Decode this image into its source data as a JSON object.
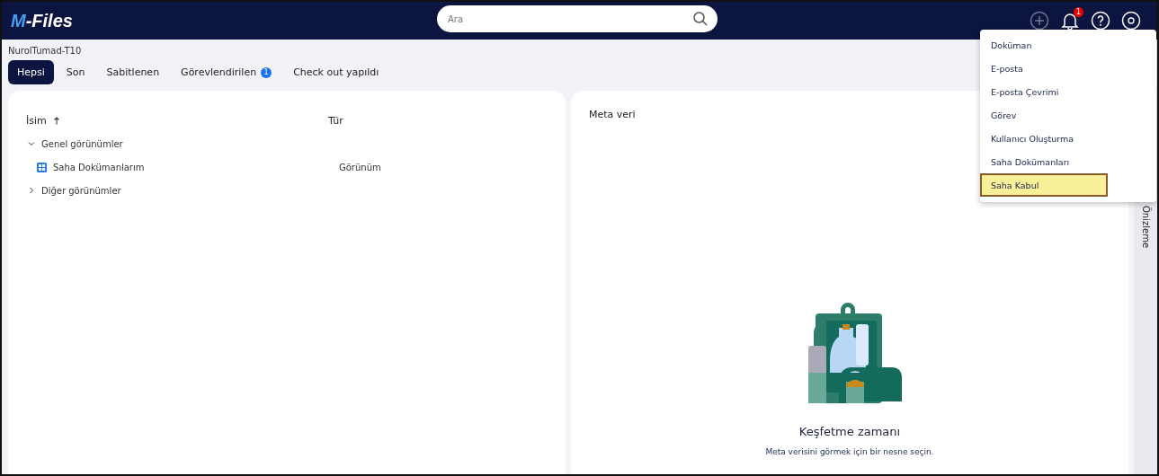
{
  "header": {
    "logo_accent": "M",
    "logo_rest": "-Files",
    "search": {
      "placeholder": "Ara"
    },
    "notification_count": "1"
  },
  "vault": "NurolTumad-T10",
  "tabs": [
    {
      "label": "Hepsi",
      "selected": true
    },
    {
      "label": "Son",
      "selected": false
    },
    {
      "label": "Sabitlenen",
      "selected": false
    },
    {
      "label": "Görevlendirilen",
      "selected": false,
      "badge": "1"
    },
    {
      "label": "Check out yapıldı",
      "selected": false
    }
  ],
  "table": {
    "columns": [
      "İsim",
      "Tür"
    ],
    "rows": [
      {
        "name": "Genel görünümler",
        "expanded": true,
        "children": [
          {
            "name": "Saha Dokümanlarım",
            "type": "Görünüm"
          }
        ]
      },
      {
        "name": "Diğer görünümler",
        "expanded": false,
        "children": []
      }
    ]
  },
  "metadata": {
    "title": "Meta veri",
    "empty_title": "Keşfetme zamanı",
    "empty_text": "Meta verisini görmek için bir nesne seçin."
  },
  "side_tab": "Önizleme",
  "new_menu": [
    {
      "label": "Doküman",
      "highlighted": false
    },
    {
      "label": "E-posta",
      "highlighted": false
    },
    {
      "label": "E-posta Çevrimi",
      "highlighted": false
    },
    {
      "label": "Görev",
      "highlighted": false
    },
    {
      "label": "Kullanıcı Oluşturma",
      "highlighted": false
    },
    {
      "label": "Saha Dokümanları",
      "highlighted": false
    },
    {
      "label": "Saha Kabul",
      "highlighted": true
    }
  ]
}
